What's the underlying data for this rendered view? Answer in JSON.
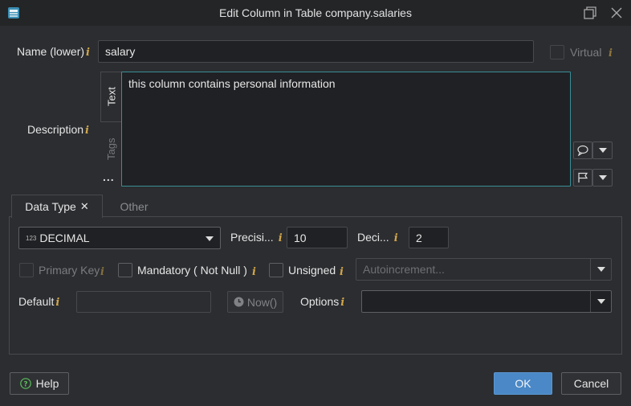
{
  "window": {
    "title": "Edit Column in Table company.salaries"
  },
  "name": {
    "label": "Name (lower)",
    "info": "i",
    "value": "salary"
  },
  "virtual": {
    "label": "Virtual",
    "info": "i"
  },
  "description": {
    "label": "Description",
    "info": "i",
    "value": "this column contains personal information",
    "tabs": [
      "Text",
      "Tags"
    ],
    "more": "..."
  },
  "tabs": {
    "data_type": "Data Type",
    "close": "✕",
    "other": "Other"
  },
  "datatype": {
    "prefix": "123",
    "value": "DECIMAL"
  },
  "precision": {
    "label": "Precisi...",
    "info": "i",
    "value": "10"
  },
  "decimal": {
    "label": "Deci...",
    "info": "i",
    "value": "2"
  },
  "primary_key": {
    "label": "Primary Key",
    "info": "i"
  },
  "mandatory": {
    "label": "Mandatory ( Not Null )",
    "info": "i"
  },
  "unsigned": {
    "label": "Unsigned",
    "info": "i"
  },
  "autoincrement": {
    "placeholder": "Autoincrement..."
  },
  "default": {
    "label": "Default",
    "info": "i",
    "value": ""
  },
  "now_button": {
    "label": "Now()"
  },
  "options": {
    "label": "Options",
    "info": "i",
    "value": ""
  },
  "footer": {
    "help": "Help",
    "ok": "OK",
    "cancel": "Cancel"
  },
  "colors": {
    "accent": "#4a88c7",
    "focus_border": "#3a8e96",
    "info": "#d2a64a",
    "help_icon": "#5bbf5b"
  },
  "icons": {
    "app": "database-table-icon",
    "restore": "restore-window-icon",
    "close": "close-icon",
    "comment": "speech-bubble-icon",
    "flag": "flag-icon",
    "clock": "clock-icon",
    "help": "question-circle-icon"
  }
}
